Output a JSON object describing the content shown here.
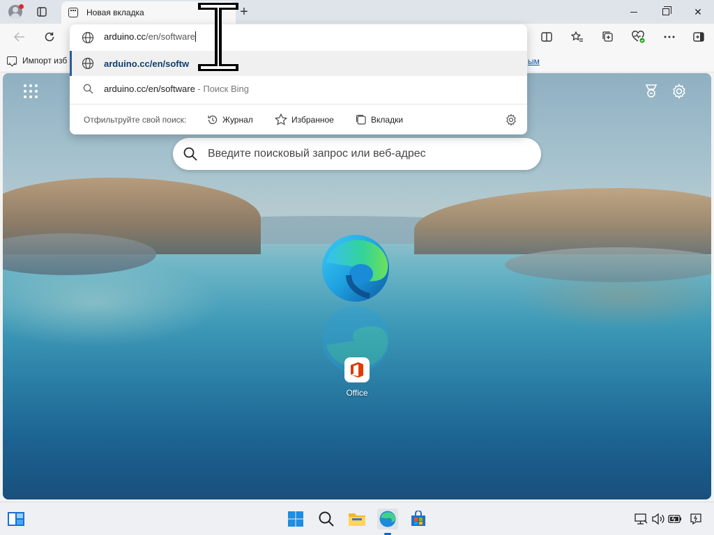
{
  "browser": {
    "tab_title": "Новая вкладка",
    "new_tab_symbol": "+",
    "window_controls": {
      "minimize": "minimize-icon",
      "maximize": "restore-icon",
      "close": "✕"
    }
  },
  "favorites_bar": {
    "import_label": "Импорт изб",
    "link_fragment": "ым"
  },
  "omnibox": {
    "typed_host": "arduino.cc",
    "typed_path": "/en/software",
    "suggestions": [
      {
        "text": "arduino.cc/en/softw",
        "icon": "globe-icon"
      },
      {
        "text": "arduino.cc/en/software",
        "sub": " - Поиск Bing",
        "icon": "search-icon"
      }
    ],
    "filter_label": "Отфильтруйте свой поиск:",
    "filters": [
      {
        "label": "Журнал",
        "icon": "history-icon"
      },
      {
        "label": "Избранное",
        "icon": "star-icon"
      },
      {
        "label": "Вкладки",
        "icon": "tabs-icon"
      }
    ]
  },
  "newtab": {
    "search_placeholder": "Введите поисковый запрос или веб-адрес",
    "tile_label": "Office"
  },
  "colors": {
    "accent": "#0a64c8",
    "suggestion_text": "#0f3e6c",
    "notification_dot": "#d92b2b"
  }
}
